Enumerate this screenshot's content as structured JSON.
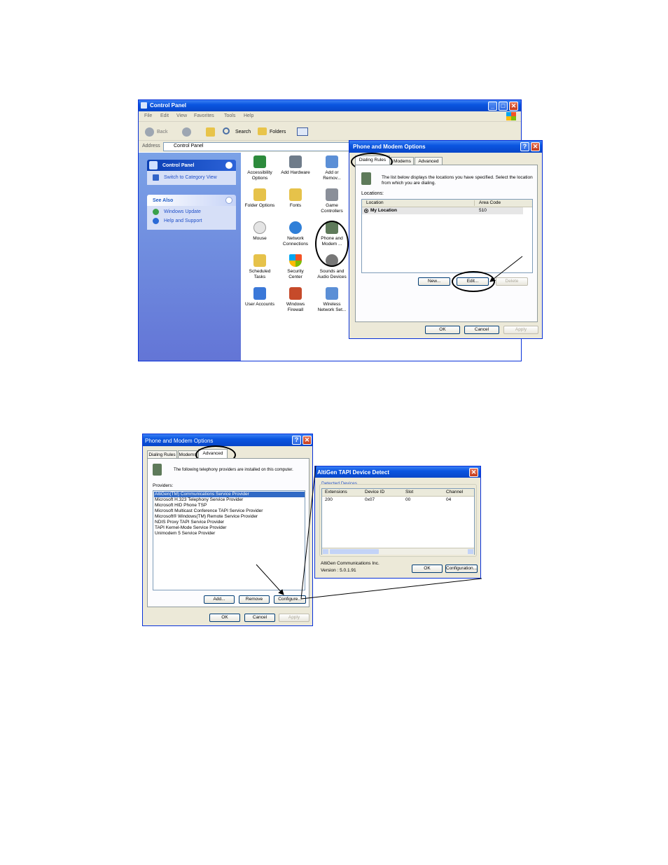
{
  "control_panel": {
    "title": "Control Panel",
    "menu": [
      "File",
      "Edit",
      "View",
      "Favorites",
      "Tools",
      "Help"
    ],
    "toolbar": {
      "back": "Back",
      "search": "Search",
      "folders": "Folders"
    },
    "address_label": "Address",
    "address_value": "Control Panel",
    "sidebar": {
      "title": "Control Panel",
      "switch_link": "Switch to Category View",
      "see_also_title": "See Also",
      "see_also_items": [
        "Windows Update",
        "Help and Support"
      ]
    },
    "icons": [
      "Accessibility\nOptions",
      "Add Hardware",
      "Add or\nRemov...",
      "Folder Options",
      "Fonts",
      "Game\nControllers",
      "Mouse",
      "Network\nConnections",
      "Phone and\nModem ...",
      "Scheduled\nTasks",
      "Security\nCenter",
      "Sounds and\nAudio Devices",
      "User Accounts",
      "Windows\nFirewall",
      "Wireless\nNetwork Set..."
    ]
  },
  "phone_dialog_1": {
    "title": "Phone and Modem Options",
    "tabs": [
      "Dialing Rules",
      "Modems",
      "Advanced"
    ],
    "description": "The list below displays the locations you have specified. Select the location from which you are dialing.",
    "locations_label": "Locations:",
    "columns": [
      "Location",
      "Area Code"
    ],
    "row": {
      "location": "My Location",
      "area_code": "510"
    },
    "buttons": {
      "new": "New...",
      "edit": "Edit...",
      "delete": "Delete"
    },
    "footer": {
      "ok": "OK",
      "cancel": "Cancel",
      "apply": "Apply"
    }
  },
  "phone_dialog_2": {
    "title": "Phone and Modem Options",
    "tabs": [
      "Dialing Rules",
      "Modems",
      "Advanced"
    ],
    "description": "The following telephony providers are installed on this computer.",
    "providers_label": "Providers:",
    "providers": [
      "AltiGen(TM) Communications Service Provider",
      "Microsoft H.323 Telephony Service Provider",
      "Microsoft HID Phone TSP",
      "Microsoft Multicast Conference TAPI Service Provider",
      "Microsoft® Windows(TM) Remote Service Provider",
      "NDIS Proxy TAPI Service Provider",
      "TAPI Kernel-Mode Service Provider",
      "Unimodem 5 Service Provider"
    ],
    "buttons": {
      "add": "Add...",
      "remove": "Remove",
      "configure": "Configure..."
    },
    "footer": {
      "ok": "OK",
      "cancel": "Cancel",
      "apply": "Apply"
    }
  },
  "altigen_dialog": {
    "title": "AltiGen TAPI Device Detect",
    "group_label": "Detected Devices",
    "columns": [
      "Extensions",
      "Device ID",
      "Slot",
      "Channel"
    ],
    "row": [
      "200",
      "0x07",
      "00",
      "04"
    ],
    "company": "AltiGen Communications Inc.",
    "version": "Version : 5.0.1.91",
    "buttons": {
      "ok": "OK",
      "configuration": "Configuration..."
    }
  }
}
